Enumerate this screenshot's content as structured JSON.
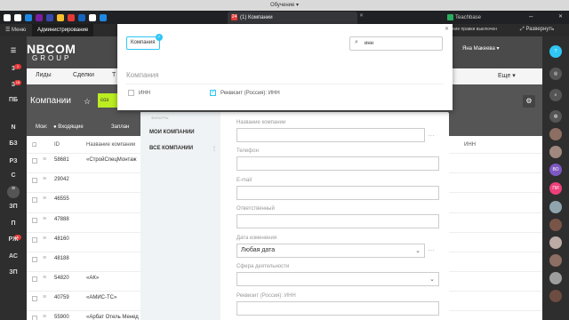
{
  "browser": {
    "window_title": "Обучение ▾",
    "active_tab": "(1) Компании",
    "tab_badge": "24",
    "second_tab": "Teachbase",
    "menu_label": "Меню",
    "admin_label": "Администрирование",
    "permission_text": "ение правки выключен",
    "expand_label": "Развернуть"
  },
  "sidebar": {
    "items": [
      "3",
      "З",
      "ПБ",
      "N",
      "БЗ",
      "РЗ",
      "С",
      "ЗП",
      "П",
      "РЖ",
      "АС",
      "ЗП"
    ],
    "badges": [
      "1",
      "18",
      "1"
    ]
  },
  "header": {
    "logo_line1": "NBCOM",
    "logo_line2": "GROUP",
    "user_name": "Яна Макеева ▾"
  },
  "nav": {
    "items": [
      "Лиды",
      "Сделки",
      "Т"
    ],
    "more": "Еще ▾"
  },
  "page": {
    "title": "Компании",
    "create_label": "соз"
  },
  "filter_row": {
    "mine": "Мои:",
    "incoming": "Входящие",
    "planned": "Заплан"
  },
  "table": {
    "col_id": "ID",
    "col_name": "Название компании",
    "col_inn": "ИНН",
    "rows": [
      {
        "id": "58681",
        "name": "«СтройСпецМонтаж"
      },
      {
        "id": "29042",
        "name": ""
      },
      {
        "id": "46555",
        "name": ""
      },
      {
        "id": "47888",
        "name": ""
      },
      {
        "id": "48160",
        "name": ""
      },
      {
        "id": "48188",
        "name": ""
      },
      {
        "id": "54820",
        "name": "«АК»"
      },
      {
        "id": "40759",
        "name": "«АМИС-ТС»"
      },
      {
        "id": "55900",
        "name": "«Арбат Отель Менед"
      }
    ]
  },
  "panel": {
    "left_title": "ФИЛЬТРЫ",
    "my_companies": "МОИ КОМПАНИИ",
    "all_companies": "ВСЕ КОМПАНИИ",
    "fields": [
      {
        "label": "Название компании",
        "value": ""
      },
      {
        "label": "Телефон",
        "value": ""
      },
      {
        "label": "E-mail",
        "value": ""
      },
      {
        "label": "Ответственный",
        "value": ""
      },
      {
        "label": "Дата изменения",
        "value": "Любая дата"
      },
      {
        "label": "Сфера деятельности",
        "value": ""
      },
      {
        "label": "Реквизит (Россия): ИНН",
        "value": ""
      }
    ]
  },
  "popup": {
    "chip_label": "Компания",
    "search_value": "инн",
    "section_title": "Компания",
    "option1": "ИНН",
    "option2": "Реквизит (Россия): ИНН"
  },
  "right_sidebar": {
    "avatars": [
      "ВО",
      "ПИ"
    ]
  },
  "colors": {
    "accent": "#2fc6f6",
    "create_button": "#bbed21",
    "badge": "#e53935"
  }
}
